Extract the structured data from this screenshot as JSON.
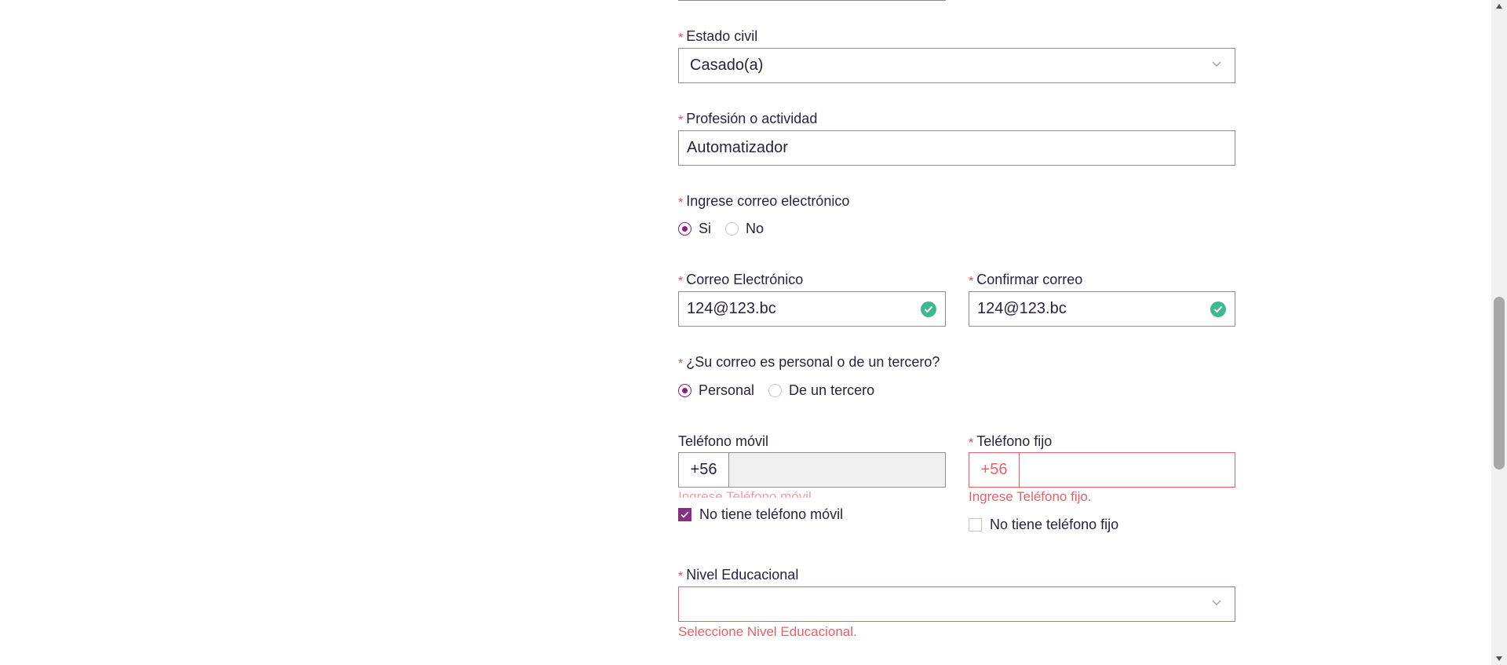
{
  "form": {
    "estado_civil": {
      "label": "Estado civil",
      "required_mark": "*",
      "value": "Casado(a)"
    },
    "profesion": {
      "label": "Profesión o actividad",
      "required_mark": "*",
      "value": "Automatizador"
    },
    "ingrese_correo": {
      "label": "Ingrese correo electrónico",
      "required_mark": "*",
      "options": [
        {
          "label": "Si",
          "selected": true
        },
        {
          "label": "No",
          "selected": false
        }
      ]
    },
    "correo": {
      "label": "Correo Electrónico",
      "required_mark": "*",
      "value": "124@123.bc",
      "valid": true
    },
    "confirmar_correo": {
      "label": "Confirmar correo",
      "required_mark": "*",
      "value": "124@123.bc",
      "valid": true
    },
    "tipo_correo": {
      "label": "¿Su correo es personal o de un tercero?",
      "required_mark": "*",
      "options": [
        {
          "label": "Personal",
          "selected": true
        },
        {
          "label": "De un tercero",
          "selected": false
        }
      ]
    },
    "telefono_movil": {
      "label": "Teléfono móvil",
      "prefix": "+56",
      "value": "",
      "error": "Ingrese Teléfono móvil.",
      "checkbox_label": "No tiene teléfono móvil",
      "checkbox_checked": true
    },
    "telefono_fijo": {
      "label": "Teléfono fijo",
      "required_mark": "*",
      "prefix": "+56",
      "value": "",
      "error": "Ingrese Teléfono fijo.",
      "checkbox_label": "No tiene teléfono fijo",
      "checkbox_checked": false
    },
    "nivel_educacional": {
      "label": "Nivel Educacional",
      "required_mark": "*",
      "value": "",
      "error": "Seleccione Nivel Educacional."
    }
  },
  "colors": {
    "accent": "#8a1c7c",
    "error": "#e8606a",
    "valid": "#3fb88f",
    "text": "#2a1f3d"
  },
  "icons": {
    "select_chevron": "chevron-down-icon",
    "valid_check": "check-circle-icon",
    "scroll_up": "arrow-up-icon",
    "scroll_down": "arrow-down-icon"
  }
}
